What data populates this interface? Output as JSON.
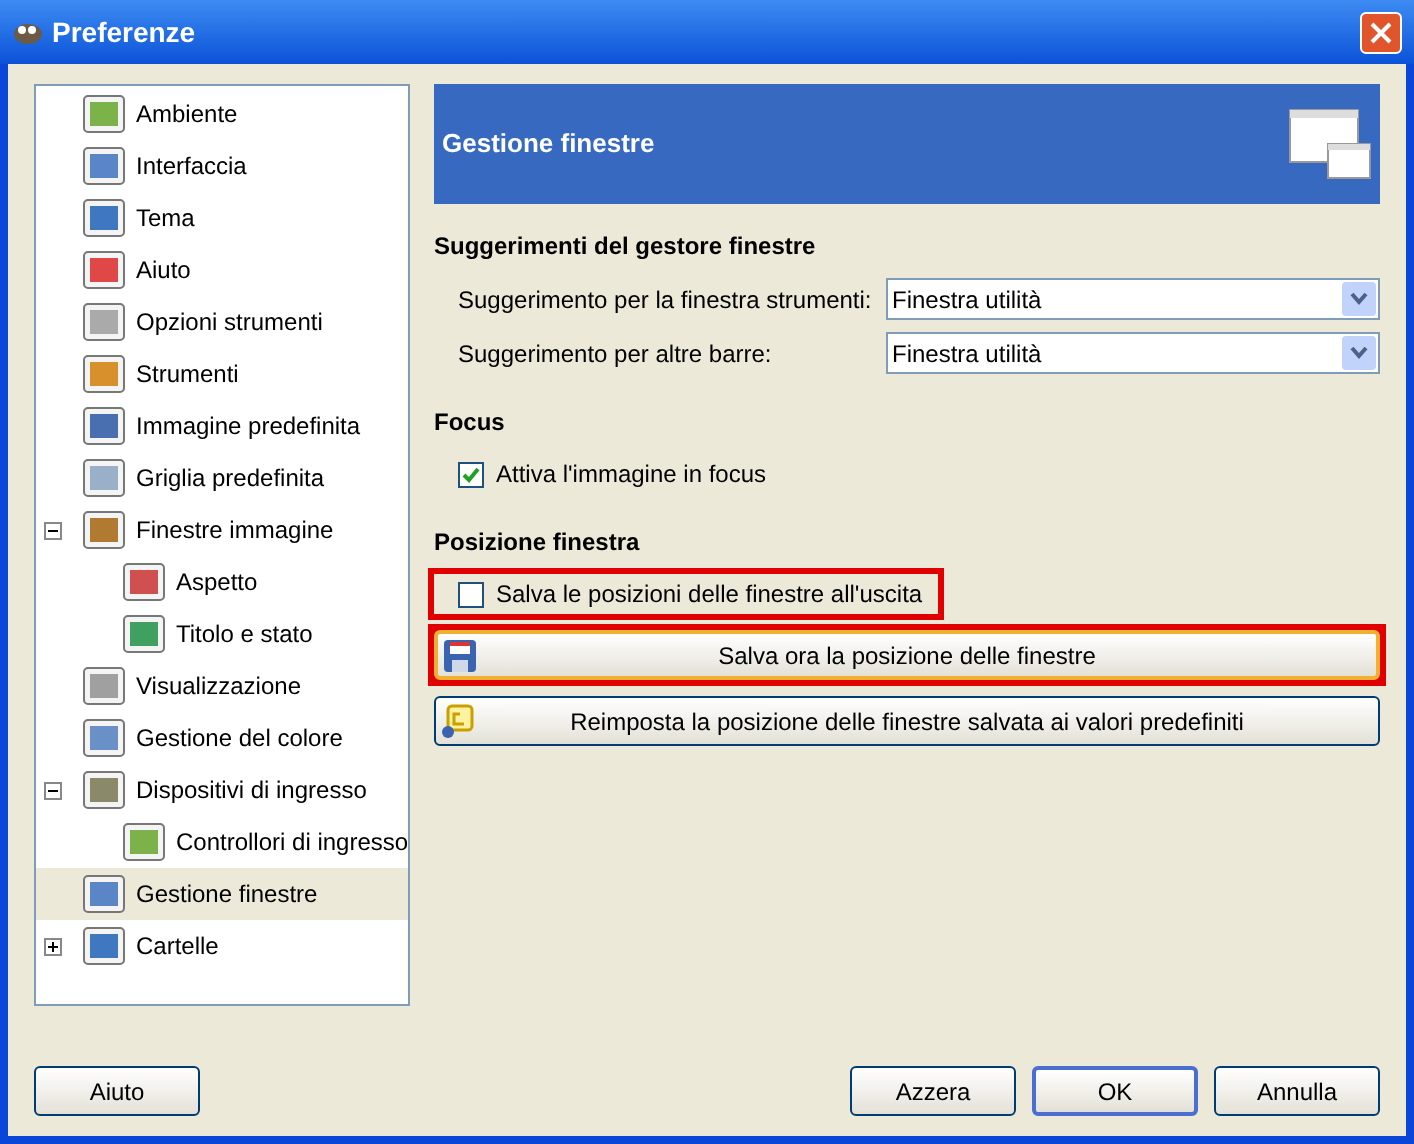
{
  "window": {
    "title": "Preferenze"
  },
  "tree": [
    {
      "label": "Ambiente",
      "selected": false
    },
    {
      "label": "Interfaccia",
      "selected": false
    },
    {
      "label": "Tema",
      "selected": false
    },
    {
      "label": "Aiuto",
      "selected": false
    },
    {
      "label": "Opzioni strumenti",
      "selected": false
    },
    {
      "label": "Strumenti",
      "selected": false
    },
    {
      "label": "Immagine predefinita",
      "selected": false
    },
    {
      "label": "Griglia predefinita",
      "selected": false
    },
    {
      "label": "Finestre immagine",
      "selected": false,
      "expanded": true,
      "children": [
        {
          "label": "Aspetto",
          "selected": false
        },
        {
          "label": "Titolo e stato",
          "selected": false
        }
      ]
    },
    {
      "label": "Visualizzazione",
      "selected": false
    },
    {
      "label": "Gestione del colore",
      "selected": false
    },
    {
      "label": "Dispositivi di ingresso",
      "selected": false,
      "expanded": true,
      "children": [
        {
          "label": "Controllori di ingresso",
          "selected": false
        }
      ]
    },
    {
      "label": "Gestione finestre",
      "selected": true
    },
    {
      "label": "Cartelle",
      "selected": false,
      "expanded": false
    }
  ],
  "header": {
    "title": "Gestione finestre"
  },
  "sections": [
    {
      "title": "Suggerimenti del gestore finestre",
      "items": [
        {
          "kind": "dropdown",
          "label": "Suggerimento per la finestra strumenti:",
          "value": "Finestra utilità"
        },
        {
          "kind": "dropdown",
          "label": "Suggerimento per altre barre:",
          "value": "Finestra utilità"
        }
      ]
    },
    {
      "title": "Focus",
      "items": [
        {
          "kind": "checkbox",
          "label": "Attiva l'immagine in focus",
          "checked": true,
          "highlighted": false
        }
      ]
    },
    {
      "title": "Posizione finestra",
      "items": [
        {
          "kind": "checkbox",
          "label": "Salva le posizioni delle finestre all'uscita",
          "checked": false,
          "highlighted": true
        },
        {
          "kind": "button",
          "label": "Salva ora la posizione delle finestre",
          "highlighted": true
        },
        {
          "kind": "button",
          "label": "Reimposta la posizione delle finestre salvata ai valori predefiniti",
          "highlighted": false
        }
      ]
    }
  ],
  "footer": {
    "left": [
      {
        "label": "Aiuto"
      }
    ],
    "right": [
      {
        "label": "Azzera",
        "default": false
      },
      {
        "label": "OK",
        "default": true
      },
      {
        "label": "Annulla",
        "default": false
      }
    ]
  }
}
